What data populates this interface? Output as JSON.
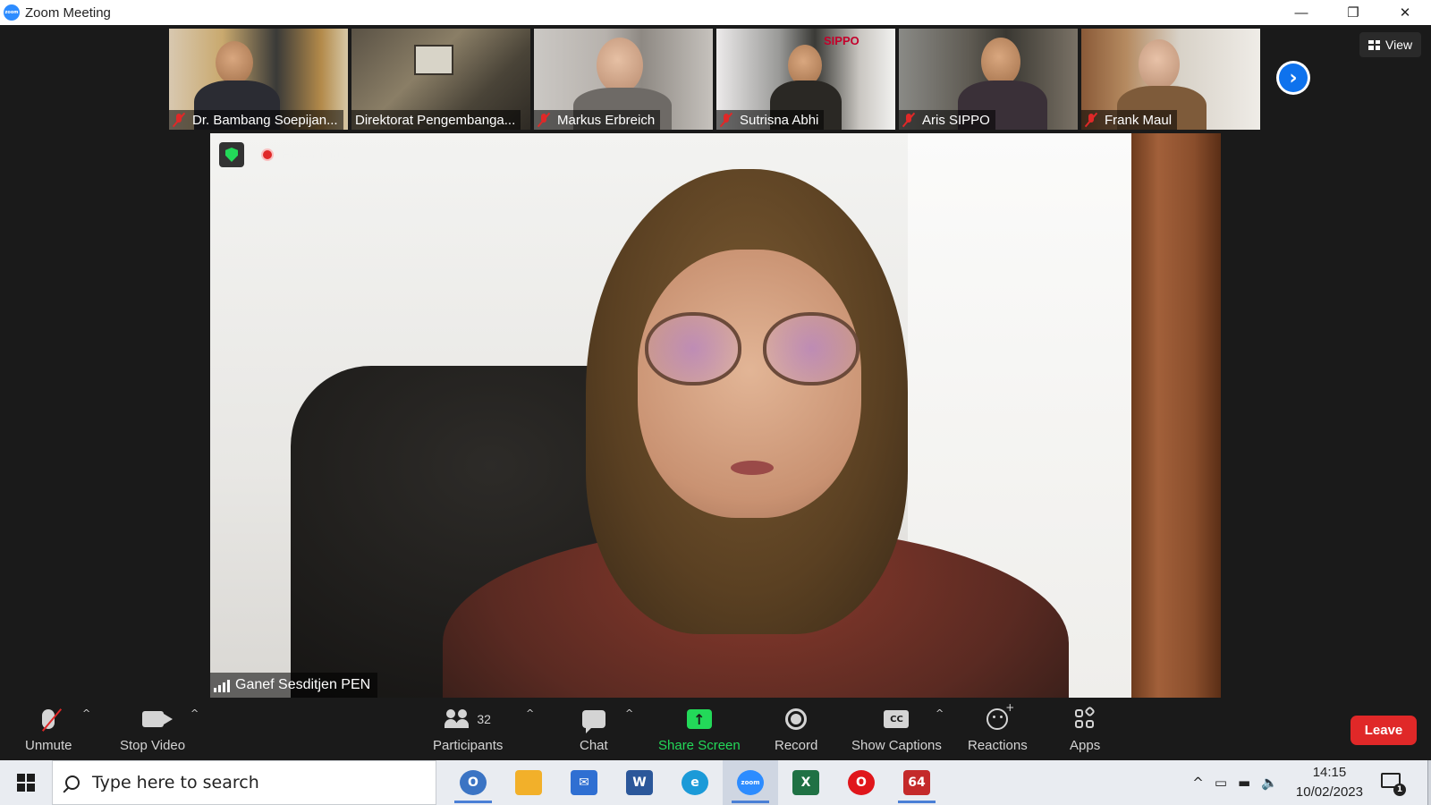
{
  "window": {
    "title": "Zoom Meeting",
    "app_logo_text": "zoom",
    "controls": {
      "minimize": "—",
      "restore": "❐",
      "close": "✕"
    }
  },
  "thumbnails": [
    {
      "name": "Dr. Bambang Soepijan...",
      "muted": true
    },
    {
      "name": "Direktorat Pengembanga...",
      "muted": false
    },
    {
      "name": "Markus Erbreich",
      "muted": true
    },
    {
      "name": "Sutrisna Abhi",
      "muted": true
    },
    {
      "name": "Aris SIPPO",
      "muted": true
    },
    {
      "name": "Frank Maul",
      "muted": true
    }
  ],
  "thumb_overlay": {
    "sippo_label": "SIPPO"
  },
  "next_page_glyph": "›",
  "view_button": {
    "label": "View"
  },
  "main_video": {
    "speaker_name": "Ganef Sesditjen PEN",
    "recording_label": "Recording..."
  },
  "toolbar": {
    "unmute": "Unmute",
    "stop_video": "Stop Video",
    "participants": "Participants",
    "participants_count": "32",
    "chat": "Chat",
    "share_screen": "Share Screen",
    "share_glyph": "↑",
    "record": "Record",
    "show_captions": "Show Captions",
    "cc_glyph": "CC",
    "reactions": "Reactions",
    "apps": "Apps",
    "leave": "Leave",
    "caret": "^"
  },
  "taskbar": {
    "search_placeholder": "Type here to search",
    "apps": [
      {
        "name": "outlook-app-icon",
        "label": "O",
        "color": "#3b74c4"
      },
      {
        "name": "file-explorer-icon",
        "label": "",
        "color": "#f2b02a"
      },
      {
        "name": "mail-icon",
        "label": "✉",
        "color": "#2f6fd2"
      },
      {
        "name": "word-icon",
        "label": "W",
        "color": "#2b579a"
      },
      {
        "name": "edge-icon",
        "label": "e",
        "color": "#1b9ad8"
      },
      {
        "name": "zoom-taskbar-icon",
        "label": "zoom",
        "color": "#2d8cff"
      },
      {
        "name": "excel-icon",
        "label": "X",
        "color": "#1f7144"
      },
      {
        "name": "opera-icon",
        "label": "O",
        "color": "#e0161b"
      },
      {
        "name": "game-icon",
        "label": "64",
        "color": "#c42a2a"
      }
    ],
    "tray": {
      "chevron": "^",
      "network": "▭",
      "battery": "▬",
      "volume": "🔈"
    },
    "time": "14:15",
    "date": "10/02/2023",
    "notification_count": "1"
  },
  "colors": {
    "accent": "#0e72ed",
    "share_green": "#23d959",
    "leave_red": "#e02828"
  }
}
